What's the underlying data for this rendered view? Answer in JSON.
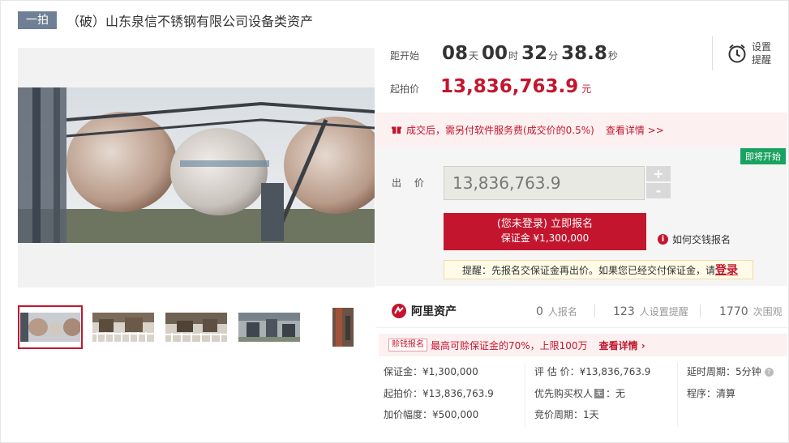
{
  "header": {
    "round_tag": "一拍",
    "title": "（破）山东泉信不锈钢有限公司设备类资产"
  },
  "countdown": {
    "label": "距开始",
    "days": "08",
    "days_unit": "天",
    "hours": "00",
    "hours_unit": "时",
    "minutes": "32",
    "minutes_unit": "分",
    "seconds": "38.8",
    "seconds_unit": "秒"
  },
  "reminder": {
    "label": "设置提醒",
    "icon": "alarm-clock-icon"
  },
  "start_price": {
    "label": "起拍价",
    "value": "13,836,763.9",
    "unit": "元"
  },
  "fee_notice": {
    "text": "成交后，需另付软件服务费(成交价的0.5%)",
    "link": "查看详情 >>",
    "icon": "gift-icon"
  },
  "bid": {
    "status_badge": "即将开始",
    "label": "出 价",
    "input_value": "13,836,763.9",
    "plus": "+",
    "minus": "-",
    "register_line1": "(您未登录) 立即报名",
    "register_line2": "保证金 ¥1,300,000",
    "howto": "如何交钱报名",
    "hint_prefix": "提醒：先报名交保证金再出价。如果您已经交付保证金，请",
    "hint_login": "登录"
  },
  "stats": {
    "brand": "阿里资产",
    "registrations": {
      "num": "0",
      "label": "人报名"
    },
    "reminders": {
      "num": "123",
      "label": "人设置提醒"
    },
    "views": {
      "num": "1770",
      "label": "次围观"
    }
  },
  "promo": {
    "badge": "赊钱报名",
    "text": "最高可赊保证金的70%，上限100万",
    "link": "查看详情"
  },
  "details": {
    "col1": [
      "保证金：¥1,300,000",
      "起拍价：¥13,836,763.9",
      "加价幅度：¥500,000"
    ],
    "col2_row1": "评 估 价：¥13,836,763.9",
    "col2_row2_prefix": "优先购买权人",
    "col2_row2_icon": "无",
    "col2_row2_suffix": "：无",
    "col2_row3": "竞价周期：1天",
    "col3": [
      "延时周期：5分钟",
      "程序：清算"
    ]
  },
  "colors": {
    "accent": "#c3162e",
    "badge_green": "#1aa260",
    "round_tag": "#6f7f95"
  }
}
